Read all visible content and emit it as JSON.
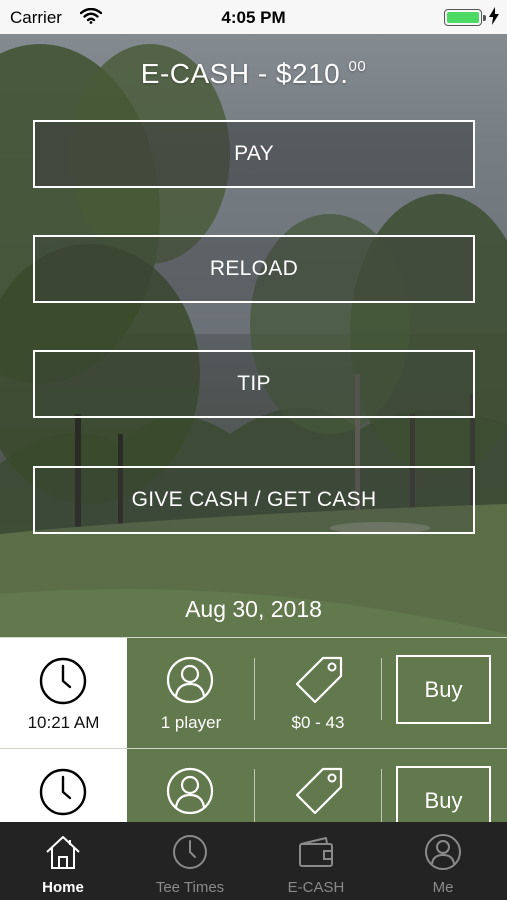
{
  "status_bar": {
    "carrier": "Carrier",
    "time": "4:05 PM"
  },
  "balance": {
    "label": "E-CASH - $210.",
    "cents": "00"
  },
  "actions": {
    "pay": "PAY",
    "reload": "RELOAD",
    "tip": "TIP",
    "give_get": "GIVE CASH / GET CASH"
  },
  "date": "Aug 30, 2018",
  "tee_times": [
    {
      "time": "10:21 AM",
      "players": "1 player",
      "price": "$0 - 43",
      "buy_label": "Buy"
    },
    {
      "time": "",
      "players": "",
      "price": "",
      "buy_label": "Buy"
    }
  ],
  "tabs": [
    {
      "label": "Home",
      "icon": "home-icon",
      "active": true
    },
    {
      "label": "Tee Times",
      "icon": "clock-icon",
      "active": false
    },
    {
      "label": "E-CASH",
      "icon": "wallet-icon",
      "active": false
    },
    {
      "label": "Me",
      "icon": "user-icon",
      "active": false
    }
  ],
  "colors": {
    "battery": "#4cd964",
    "tab_bar": "#232323",
    "tab_inactive": "#8a8a8a"
  }
}
